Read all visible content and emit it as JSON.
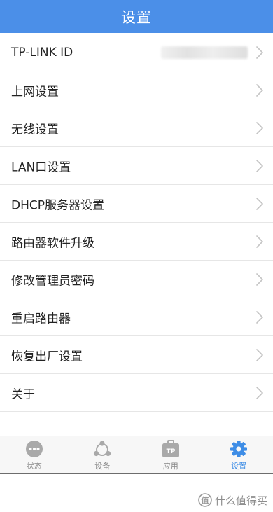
{
  "header": {
    "title": "设置"
  },
  "settings": {
    "items": [
      {
        "label": "TP-LINK ID",
        "value_redacted": true
      },
      {
        "label": "上网设置"
      },
      {
        "label": "无线设置"
      },
      {
        "label": "LAN口设置"
      },
      {
        "label": "DHCP服务器设置"
      },
      {
        "label": "路由器软件升级"
      },
      {
        "label": "修改管理员密码"
      },
      {
        "label": "重启路由器"
      },
      {
        "label": "恢复出厂设置"
      },
      {
        "label": "关于"
      }
    ]
  },
  "tabbar": {
    "tabs": [
      {
        "label": "状态",
        "icon": "status-dots-icon",
        "active": false
      },
      {
        "label": "设备",
        "icon": "devices-icon",
        "active": false
      },
      {
        "label": "应用",
        "icon": "apps-tp-icon",
        "active": false
      },
      {
        "label": "设置",
        "icon": "gear-icon",
        "active": true
      }
    ]
  },
  "watermark": {
    "text": "什么值得买"
  },
  "colors": {
    "header_bg": "#4b8fe8",
    "active_tab": "#3e8de6",
    "inactive_tab": "#888888"
  }
}
